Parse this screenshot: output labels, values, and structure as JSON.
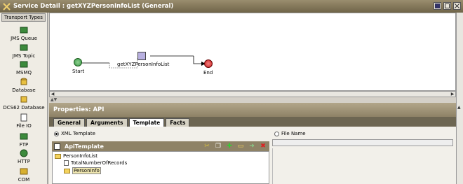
{
  "window": {
    "title": "Service Detail : getXYZPersonInfoList (General)"
  },
  "sidebar": {
    "header": "Transport Types",
    "items": [
      {
        "label": "JMS Queue",
        "icon": "jms-queue-icon"
      },
      {
        "label": "JMS Topic",
        "icon": "jms-topic-icon"
      },
      {
        "label": "MSMQ",
        "icon": "msmq-icon"
      },
      {
        "label": "Database",
        "icon": "database-icon"
      },
      {
        "label": "DCS62 Database",
        "icon": "dcs62-database-icon"
      },
      {
        "label": "File IO",
        "icon": "file-io-icon"
      },
      {
        "label": "FTP",
        "icon": "ftp-icon"
      },
      {
        "label": "HTTP",
        "icon": "http-icon"
      },
      {
        "label": "COM",
        "icon": "com-icon"
      }
    ]
  },
  "canvas": {
    "nodes": {
      "start": "Start",
      "api": "getXYZPersonInfoList",
      "end": "End"
    },
    "colors": {
      "start": "#3a9a4a",
      "end": "#d02020"
    }
  },
  "properties": {
    "title": "Properties: API",
    "tabs": [
      "General",
      "Arguments",
      "Template",
      "Facts"
    ],
    "active_tab": "Template",
    "radio_xml": "XML Template",
    "radio_file": "File Name",
    "api_template_title": "ApiTemplate",
    "tree": {
      "root": "PersonInfoList",
      "child1": "TotalNumberOfRecords",
      "child2": "PersonInfo"
    }
  }
}
